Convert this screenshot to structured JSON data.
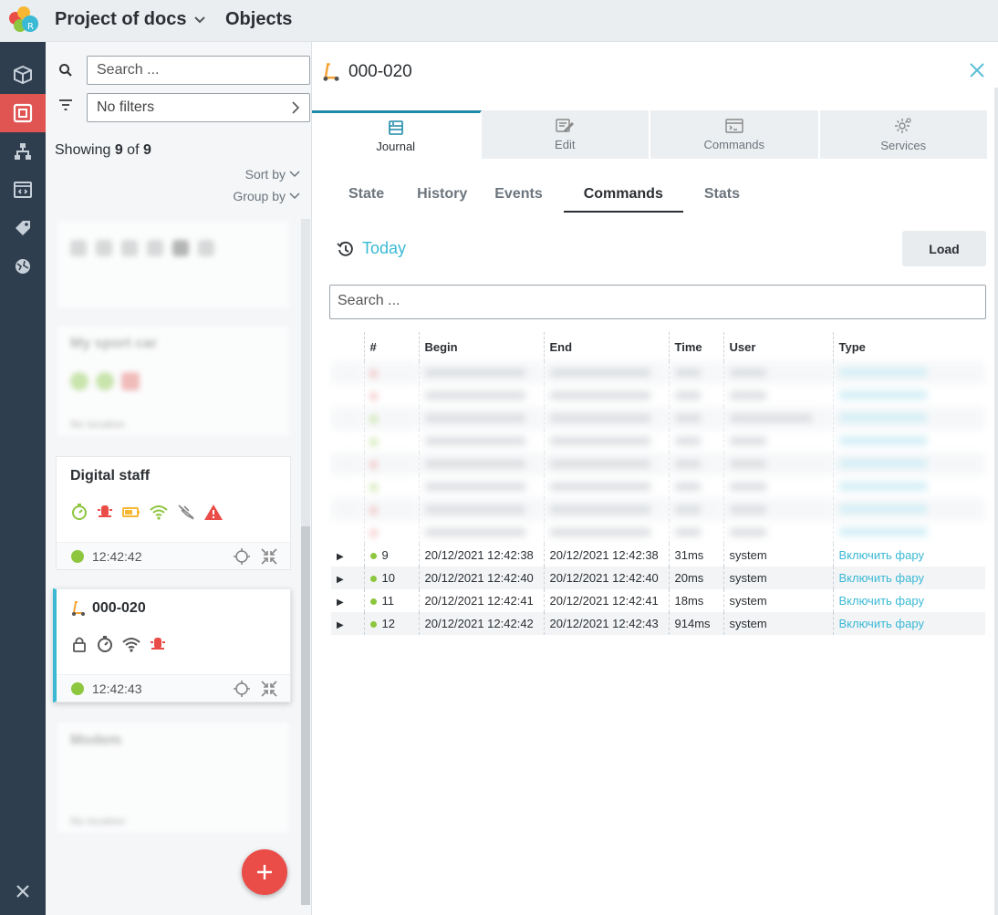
{
  "header": {
    "project": "Project of docs",
    "section": "Objects"
  },
  "sidebar": {
    "search_placeholder": "Search ...",
    "filter_label": "No filters",
    "showing_prefix": "Showing ",
    "showing_count": "9",
    "showing_of": " of ",
    "showing_total": "9",
    "sort_label": "Sort by",
    "group_label": "Group by",
    "blurred_card_2_name": "My sport car",
    "blurred_card_4_name": "Modem",
    "blurred_footer_text": "No location"
  },
  "objects": [
    {
      "name": "Digital staff",
      "time": "12:42:42"
    },
    {
      "name": "000-020",
      "time": "12:42:43"
    }
  ],
  "detail": {
    "title": "000-020",
    "tabs": [
      "Journal",
      "Edit",
      "Commands",
      "Services"
    ],
    "subtabs": [
      "State",
      "History",
      "Events",
      "Commands",
      "Stats"
    ],
    "period": "Today",
    "load_label": "Load",
    "search_placeholder": "Search ..."
  },
  "table": {
    "columns": [
      "#",
      "Begin",
      "End",
      "Time",
      "User",
      "Type"
    ],
    "rows": [
      {
        "n": "9",
        "begin": "20/12/2021 12:42:38",
        "end": "20/12/2021 12:42:38",
        "time": "31ms",
        "user": "system",
        "type": "Включить фару"
      },
      {
        "n": "10",
        "begin": "20/12/2021 12:42:40",
        "end": "20/12/2021 12:42:40",
        "time": "20ms",
        "user": "system",
        "type": "Включить фару"
      },
      {
        "n": "11",
        "begin": "20/12/2021 12:42:41",
        "end": "20/12/2021 12:42:41",
        "time": "18ms",
        "user": "system",
        "type": "Включить фару"
      },
      {
        "n": "12",
        "begin": "20/12/2021 12:42:42",
        "end": "20/12/2021 12:42:43",
        "time": "914ms",
        "user": "system",
        "type": "Включить фару"
      }
    ]
  },
  "colors": {
    "accent": "#3ab9d4",
    "danger": "#ea4d48",
    "ok": "#8dc63f",
    "rail": "#2e3e4e"
  },
  "icons": [
    "search-icon",
    "filter-icon",
    "cube-icon",
    "object-icon",
    "hierarchy-icon",
    "code-icon",
    "tag-icon",
    "globe-icon",
    "tools-icon",
    "scooter-icon",
    "close-icon",
    "journal-icon",
    "edit-icon",
    "commands-icon",
    "services-icon",
    "history-icon",
    "lock-icon",
    "timer-icon",
    "wifi-icon",
    "beacon-icon",
    "battery-icon",
    "plug-icon",
    "warning-icon",
    "target-icon",
    "collapse-icon",
    "plus-icon"
  ]
}
